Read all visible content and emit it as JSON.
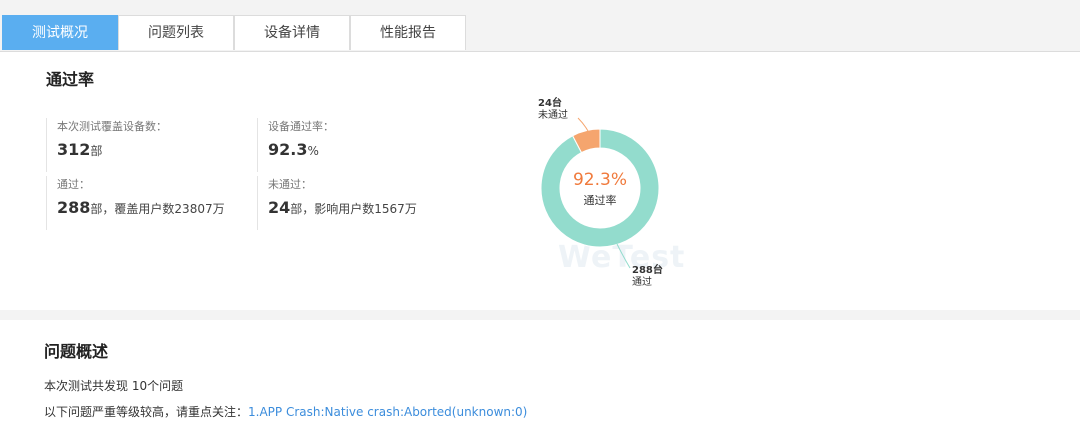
{
  "tabs": [
    {
      "label": "测试概况",
      "active": true
    },
    {
      "label": "问题列表",
      "active": false
    },
    {
      "label": "设备详情",
      "active": false
    },
    {
      "label": "性能报告",
      "active": false
    }
  ],
  "pass_rate_section": {
    "title": "通过率",
    "stats": {
      "devices_covered": {
        "label": "本次测试覆盖设备数：",
        "value": "312",
        "unit": "部"
      },
      "device_pass_rate": {
        "label": "设备通过率：",
        "value": "92.3",
        "unit": "%"
      },
      "passed": {
        "label": "通过：",
        "value": "288",
        "unit": "部",
        "extra": "，覆盖用户数23807万"
      },
      "failed": {
        "label": "未通过：",
        "value": "24",
        "unit": "部",
        "extra": "，影响用户数1567万"
      }
    }
  },
  "chart_data": {
    "type": "pie",
    "donut": true,
    "center_value": "92.3%",
    "center_label": "通过率",
    "slices": [
      {
        "label": "通过",
        "count_label": "288台",
        "value": 288,
        "color": "#93dccd"
      },
      {
        "label": "未通过",
        "count_label": "24台",
        "value": 24,
        "color": "#f5a56e"
      }
    ],
    "watermark": "WeTest"
  },
  "issues_section": {
    "title": "问题概述",
    "summary": "本次测试共发现 10个问题",
    "focus_prefix": "以下问题严重等级较高，请重点关注：",
    "focus_link": "1.APP Crash:Native crash:Aborted(unknown:0)"
  }
}
